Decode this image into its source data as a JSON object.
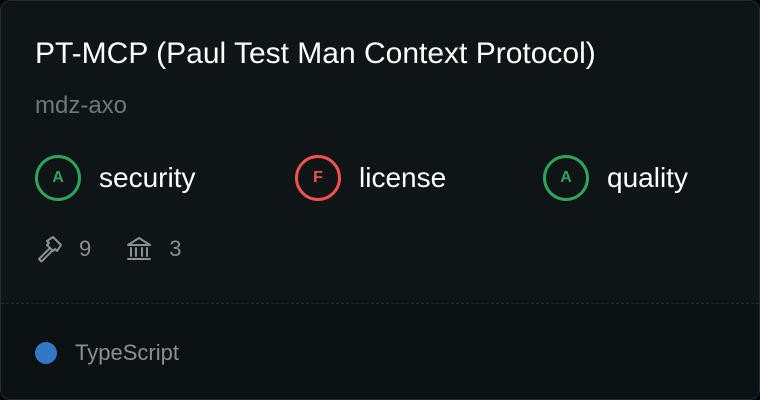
{
  "card": {
    "title": "PT-MCP (Paul Test Man Context Protocol)",
    "owner": "mdz-axo"
  },
  "scores": [
    {
      "grade": "A",
      "label": "security",
      "color": "#2ea35a"
    },
    {
      "grade": "F",
      "label": "license",
      "color": "#f05252"
    },
    {
      "grade": "A",
      "label": "quality",
      "color": "#2ea35a"
    }
  ],
  "stats": {
    "tools": {
      "icon": "hammer-icon",
      "value": "9"
    },
    "resources": {
      "icon": "bank-icon",
      "value": "3"
    }
  },
  "language": {
    "name": "TypeScript",
    "color": "#3178c6"
  }
}
